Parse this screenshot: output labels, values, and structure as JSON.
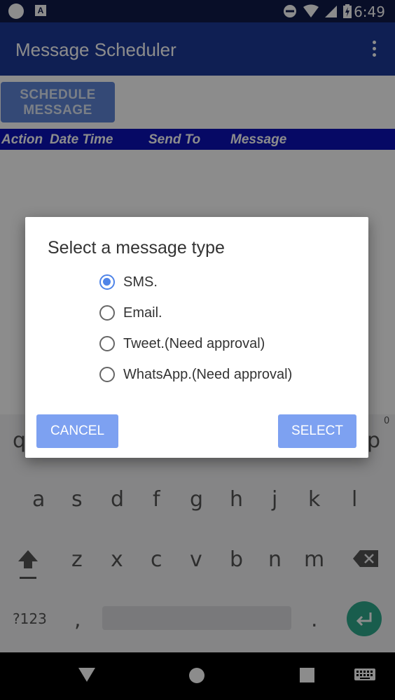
{
  "status_bar": {
    "time": "6:49"
  },
  "app_bar": {
    "title": "Message Scheduler"
  },
  "schedule_button": {
    "line1": "SCHEDULE",
    "line2": "MESSAGE"
  },
  "table_header": [
    "Action",
    "Date Time",
    "Send To",
    "Message"
  ],
  "dialog": {
    "title": "Select a message type",
    "options": [
      {
        "label": "SMS.",
        "selected": true
      },
      {
        "label": "Email.",
        "selected": false
      },
      {
        "label": "Tweet.(Need approval)",
        "selected": false
      },
      {
        "label": "WhatsApp.(Need approval)",
        "selected": false
      }
    ],
    "cancel_label": "CANCEL",
    "select_label": "SELECT"
  },
  "keyboard": {
    "row1_visible": [
      "q",
      "p"
    ],
    "row1_hint": "0",
    "row2": [
      "a",
      "s",
      "d",
      "f",
      "g",
      "h",
      "j",
      "k",
      "l"
    ],
    "row3": [
      "z",
      "x",
      "c",
      "v",
      "b",
      "n",
      "m"
    ],
    "symbols_label": "?123",
    "comma": ",",
    "period": "."
  },
  "colors": {
    "status_bar": "#0f1a4a",
    "app_bar": "#1d3a98",
    "table_header": "#0b12b8",
    "accent": "#4f84e8",
    "enter_key": "#2fa98c"
  }
}
